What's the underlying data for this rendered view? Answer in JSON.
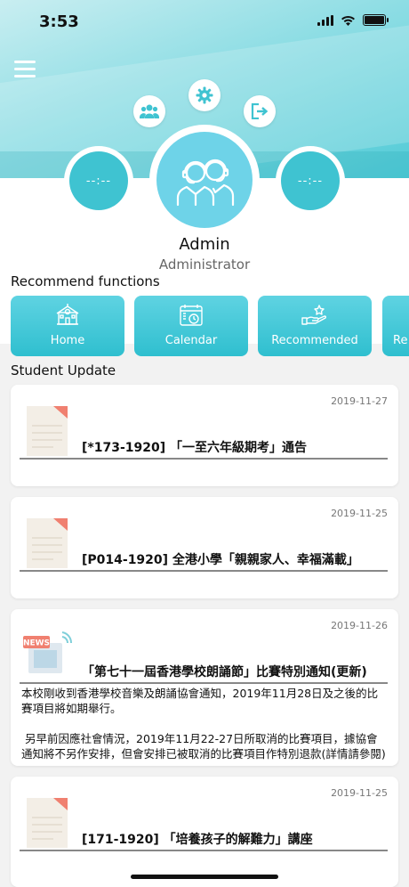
{
  "status_bar": {
    "time": "3:53"
  },
  "profile": {
    "name": "Admin",
    "role": "Administrator",
    "left_stat": "--:--",
    "right_stat": "--:--"
  },
  "recommend": {
    "title": "Recommend functions",
    "items": [
      {
        "label": "Home",
        "icon": "school-building-icon"
      },
      {
        "label": "Calendar",
        "icon": "calendar-icon"
      },
      {
        "label": "Recommended",
        "icon": "hand-star-icon"
      },
      {
        "label": "Re",
        "icon": "partial-icon"
      }
    ]
  },
  "student_update": {
    "title": "Student Update",
    "items": [
      {
        "date": "2019-11-27",
        "title": "[*173-1920] 「一至六年級期考」通告",
        "thumb": "document-icon"
      },
      {
        "date": "2019-11-25",
        "title": "[P014-1920] 全港小學「親親家人、幸福滿載」",
        "thumb": "document-icon"
      },
      {
        "date": "2019-11-26",
        "title": "「第七十一屆香港學校朗誦節」比賽特別通知(更新)",
        "thumb": "news-icon",
        "body": [
          "本校剛收到香港學校音樂及朗誦協會通知，2019年11月28日及之後的比賽項目將如期舉行。",
          "另早前因應社會情況，2019年11月22-27日所取消的比賽項目，據協會通知將不另作安排，但會安排已被取消的比賽項目作特別退款(詳情請參閱)"
        ]
      },
      {
        "date": "2019-11-25",
        "title": "[171-1920] 「培養孩子的解難力」講座",
        "thumb": "document-icon"
      }
    ]
  },
  "colors": {
    "accent": "#3fc3d1",
    "accent_light": "#6ed3e8"
  }
}
